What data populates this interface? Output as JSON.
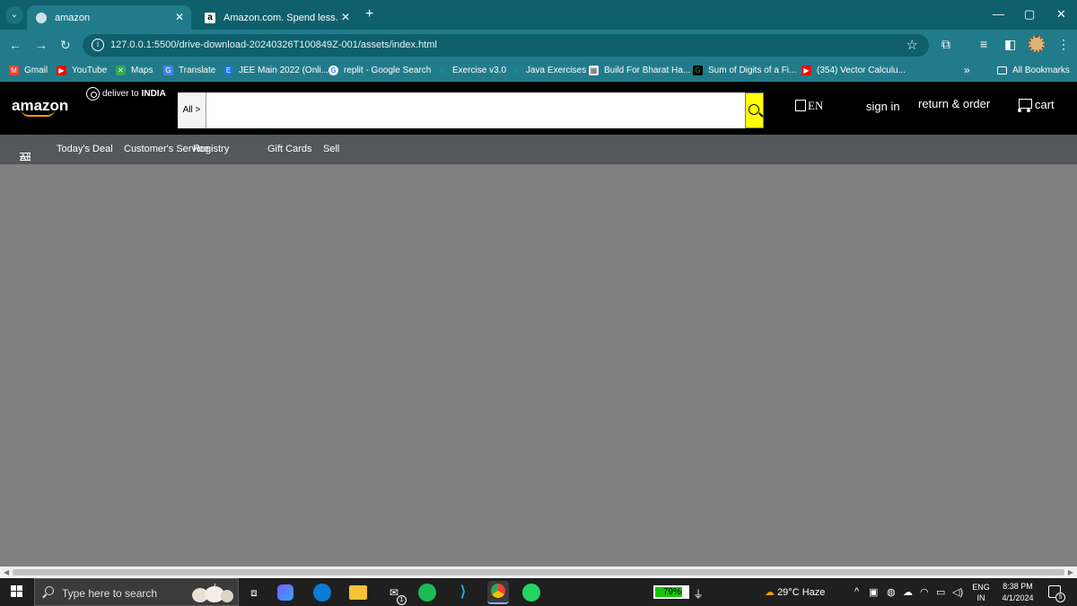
{
  "browser": {
    "tabs": [
      {
        "title": "amazon",
        "icon": "globe-icon",
        "active": true
      },
      {
        "title": "Amazon.com. Spend less. Smile",
        "icon": "amazon-a-icon",
        "active": false
      }
    ],
    "url": "127.0.0.1:5500/drive-download-20240326T100849Z-001/assets/index.html",
    "bookmarks": [
      {
        "label": "Gmail",
        "icon": "gmail-icon",
        "color": "#ea4335"
      },
      {
        "label": "YouTube",
        "icon": "youtube-icon",
        "color": "#ff0000"
      },
      {
        "label": "Maps",
        "icon": "maps-icon",
        "color": "#34a853"
      },
      {
        "label": "Translate",
        "icon": "translate-icon",
        "color": "#4285f4"
      },
      {
        "label": "JEE Main 2022 (Onli...",
        "icon": "jee-icon",
        "color": "#1a73e8"
      },
      {
        "label": "replit - Google Search",
        "icon": "google-icon",
        "color": "#ffffff"
      },
      {
        "label": "Exercise v3.0",
        "icon": "w3-icon",
        "color": "#04aa6d"
      },
      {
        "label": "Java Exercises",
        "icon": "w3-icon",
        "color": "#04aa6d"
      },
      {
        "label": "Build For Bharat Ha...",
        "icon": "hackathon-icon",
        "color": "#e8eaed"
      },
      {
        "label": "Sum of Digits of a Fi...",
        "icon": "gfg-icon",
        "color": "#2f8d46"
      },
      {
        "label": "(354) Vector Calculu...",
        "icon": "youtube-icon",
        "color": "#ff0000"
      }
    ],
    "more_bookmarks": "»",
    "all_bookmarks": "All Bookmarks"
  },
  "amazon": {
    "logo": "amazon",
    "deliver_prefix": "deliver to",
    "deliver_country": "INDIA",
    "search_category": "All >",
    "search_value": "",
    "language": "EN",
    "sign_in": "sign in",
    "returns": "return & order",
    "cart": "cart",
    "subnav": [
      "All",
      "Today's Deal",
      "Customer's Service",
      "Registry",
      "Gift Cards",
      "Sell"
    ],
    "accent": "#ff9900",
    "search_button_color": "#ffff00"
  },
  "taskbar": {
    "search_placeholder": "Type here to search",
    "battery_percent": "79%",
    "battery_level": 0.79,
    "weather": "29°C  Haze",
    "lang_top": "ENG",
    "lang_bottom": "IN",
    "time": "8:38 PM",
    "date": "4/1/2024",
    "notification_count": "5",
    "mail_badge": "1"
  }
}
